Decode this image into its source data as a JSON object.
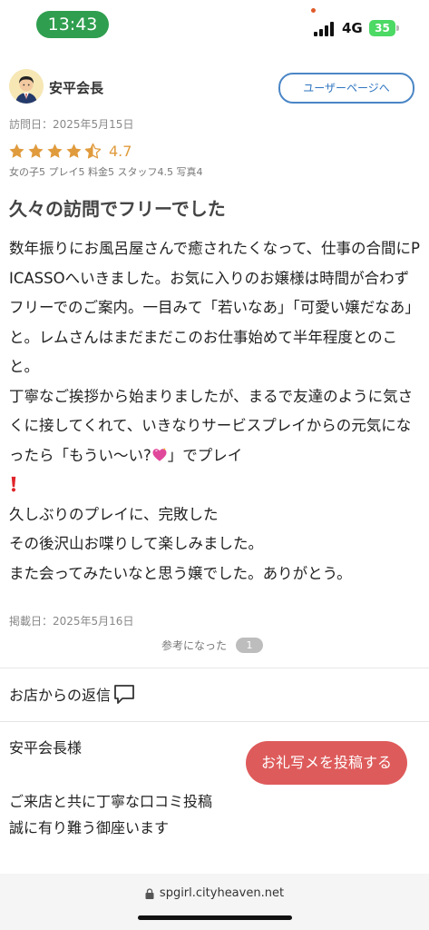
{
  "status_bar": {
    "time": "13:43",
    "network": "4G",
    "battery": "35"
  },
  "review": {
    "user_name": "安平会長",
    "user_page_button": "ユーザーページへ",
    "visit_date": "訪問日：2025年5月15日",
    "rating": 4.7,
    "rating_text": "4.7",
    "sub_ratings": "女の子5 プレイ5 料金5 スタッフ4.5 写真4",
    "title": "久々の訪問でフリーでした",
    "body_part1": "数年振りにお風呂屋さんで癒されたくなって、仕事の合間にPICASSOへいきました。お気に入りのお嬢様は時間が合わずフリーでのご案内。一目みて「若いなあ」「可愛い嬢だなあ」と。レムさんはまだまだこのお仕事始めて半年程度とのこと。\n丁寧なご挨拶から始まりましたが、まるで友達のように気さくに接してくれて、いきなりサービスプレイからの元気になったら「もうい〜い?",
    "body_part2": "」でプレイ",
    "body_part3": "\n久しぶりのプレイに、完敗した\nその後沢山お喋りして楽しみました。\nまた会ってみたいなと思う嬢でした。ありがとう。",
    "post_date": "掲載日：2025年5月16日",
    "helpful_label": "参考になった",
    "helpful_count": "1"
  },
  "reply": {
    "heading": "お店からの返信",
    "to": "安平会長様",
    "photo_button": "お礼写メを投稿する",
    "body": "ご来店と共に丁寧な口コミ投稿\n誠に有り難う御座います"
  },
  "url_bar": {
    "url": "spgirl.cityheaven.net"
  },
  "colors": {
    "time_pill": "#2f9e4f",
    "star": "#e09b3d",
    "user_page_border": "#4b86c6",
    "photo_button": "#de5b5b",
    "battery": "#4cd964"
  },
  "icons": [
    "avatar-icon",
    "star-icon",
    "heart-emoji",
    "exclamation-emoji",
    "speech-bubble-icon",
    "lock-icon"
  ]
}
